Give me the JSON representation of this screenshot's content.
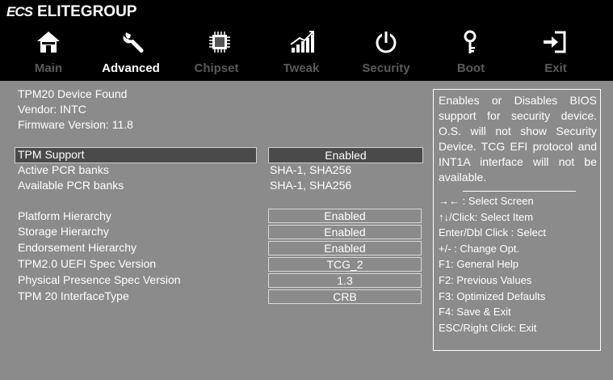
{
  "brand": {
    "logo_mark": "ECS",
    "name": "ELITEGROUP"
  },
  "icons": [
    {
      "name": "home-icon",
      "tab": "Main"
    },
    {
      "name": "wrench-icon",
      "tab": "Advanced"
    },
    {
      "name": "chip-icon",
      "tab": "Chipset"
    },
    {
      "name": "chart-icon",
      "tab": "Tweak"
    },
    {
      "name": "power-icon",
      "tab": "Security"
    },
    {
      "name": "key-icon",
      "tab": "Boot"
    },
    {
      "name": "exit-icon",
      "tab": "Exit"
    }
  ],
  "tabs": [
    {
      "label": "Main",
      "active": false
    },
    {
      "label": "Advanced",
      "active": true
    },
    {
      "label": "Chipset",
      "active": false
    },
    {
      "label": "Tweak",
      "active": false
    },
    {
      "label": "Security",
      "active": false
    },
    {
      "label": "Boot",
      "active": false
    },
    {
      "label": "Exit",
      "active": false
    }
  ],
  "info": {
    "line1": "TPM20 Device Found",
    "line2": "Vendor: INTC",
    "line3": "Firmware Version: 11.8"
  },
  "settings": {
    "tpm_support": {
      "label": "TPM Support",
      "value": "Enabled"
    },
    "active_pcr": {
      "label": "Active PCR banks",
      "value": "SHA-1, SHA256"
    },
    "available_pcr": {
      "label": "Available PCR banks",
      "value": "SHA-1, SHA256"
    },
    "platform_hierarchy": {
      "label": "Platform Hierarchy",
      "value": "Enabled"
    },
    "storage_hierarchy": {
      "label": "Storage Hierarchy",
      "value": "Enabled"
    },
    "endorsement_hierarchy": {
      "label": "Endorsement Hierarchy",
      "value": "Enabled"
    },
    "uefi_spec": {
      "label": "TPM2.0 UEFI Spec Version",
      "value": "TCG_2"
    },
    "pp_spec": {
      "label": "Physical Presence Spec Version",
      "value": "1.3"
    },
    "interface_type": {
      "label": "TPM 20 InterfaceType",
      "value": "CRB"
    }
  },
  "help": {
    "description": "Enables or Disables BIOS support for security device. O.S. will not show Security Device. TCG EFI protocol and INT1A interface will not be available.",
    "keys": [
      "→← : Select Screen",
      "↑↓/Click: Select Item",
      "Enter/Dbl Click : Select",
      "+/- : Change Opt.",
      "F1: General Help",
      "F2: Previous Values",
      "F3: Optimized Defaults",
      "F4: Save & Exit",
      "ESC/Right Click: Exit"
    ]
  }
}
